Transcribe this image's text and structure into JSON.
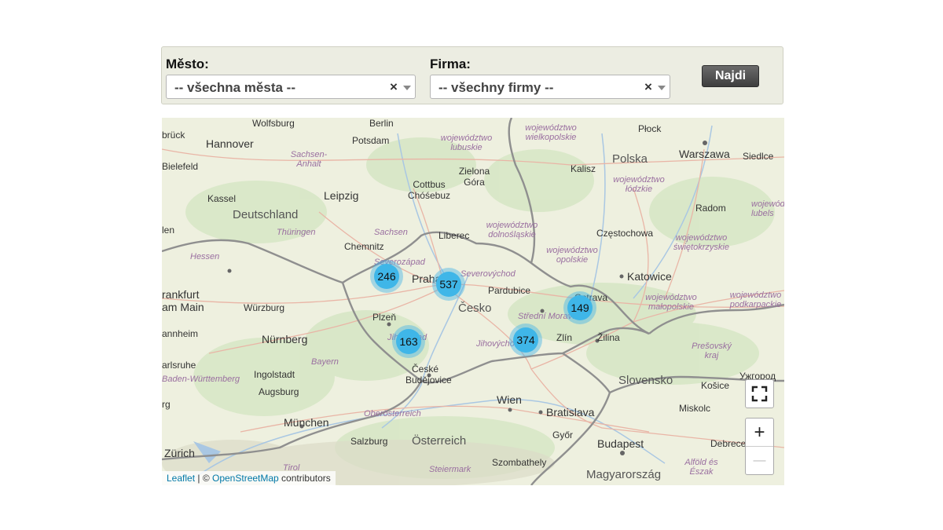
{
  "filters": {
    "city_label": "Město:",
    "city_value": "-- všechna města --",
    "company_label": "Firma:",
    "company_value": "-- všechny firmy --",
    "clear_symbol": "×",
    "search_button": "Najdi"
  },
  "map": {
    "clusters": [
      {
        "count": "246"
      },
      {
        "count": "537"
      },
      {
        "count": "163"
      },
      {
        "count": "374"
      },
      {
        "count": "149"
      }
    ],
    "labels": {
      "wolfsburg": "Wolfsburg",
      "berlin": "Berlin",
      "plock": "Płock",
      "bruck": "brück",
      "hannover": "Hannover",
      "potsdam": "Potsdam",
      "woj_lub": "województwo lubuskie",
      "woj_wlkp": "województwo wielkopolskie",
      "warszawa": "Warszawa",
      "polska": "Polska",
      "siedlce": "Siedlce",
      "bielefeld": "Bielefeld",
      "sachsen_anhalt": "Sachsen-Anhalt",
      "zielona": "Zielona Góra",
      "kalisz": "Kalisz",
      "cottbus": "Cottbus Chóśebuz",
      "woj_lodz": "województwo łódzkie",
      "kassel": "Kassel",
      "leipzig": "Leipzig",
      "deutschland": "Deutschland",
      "radom": "Radom",
      "woj_lubel": "wojewódz lubels",
      "thuringen": "Thüringen",
      "sachsen": "Sachsen",
      "liberec": "Liberec",
      "woj_dolno": "województwo dolnośląskie",
      "czestochowa": "Częstochowa",
      "en": "len",
      "chemnitz": "Chemnitz",
      "hessen": "Hessen",
      "severozapad": "Severozápad",
      "woj_opol": "województwo opolskie",
      "woj_swie": "województwo świętokrzyskie",
      "praha": "Praha",
      "severovychod": "Severovýchod",
      "katowice": "Katowice",
      "frankfurt": "rankfurt am Main",
      "wurzburg": "Würzburg",
      "pardubice": "Pardubice",
      "ostrava": "Ostrava",
      "woj_malo": "województwo małopolskie",
      "woj_podk": "województwo podkarpackie",
      "cesko": "Česko",
      "plzen": "Plzeň",
      "stredni_morava": "Střední Morava",
      "annheim": "annheim",
      "nurnberg": "Nürnberg",
      "jihozapad": "Jihozápad",
      "jihovychod": "Jihovýchod",
      "zlin": "Zlín",
      "zilina": "Žilina",
      "presovsky": "Prešovský kraj",
      "arlsruhe": "arlsruhe",
      "ingolstadt": "Ingolstadt",
      "bayern": "Bayern",
      "ceske_budejovice": "České Budějovice",
      "uzhgorod": "Ужгород",
      "bw": "Baden-Württemberg",
      "augsburg": "Augsburg",
      "slovensko": "Slovensko",
      "kosice": "Košice",
      "wien": "Wien",
      "bratislava": "Bratislava",
      "rg": "rg",
      "oberosterreich": "Oberösterreich",
      "munchen": "München",
      "miskolc": "Miskolc",
      "osterreich": "Österreich",
      "gyor": "Győr",
      "salzburg": "Salzburg",
      "budapest": "Budapest",
      "debrecen": "Debrece",
      "zurich": "Zürich",
      "szombathely": "Szombathely",
      "steiermark": "Steiermark",
      "magyarorszag": "Magyarország",
      "alfold": "Alföld és Észak",
      "tirol": "Tirol"
    },
    "zoom_in": "+",
    "zoom_out": "—",
    "attribution": {
      "leaflet": "Leaflet",
      "sep": " | © ",
      "osm": "OpenStreetMap",
      "contributors": " contributors"
    },
    "colors": {
      "cluster_fill": "#3fb6e8",
      "cluster_halo": "#46b4e6",
      "border_main": "#8f8f8f",
      "region_label": "#9a6fa0"
    }
  }
}
